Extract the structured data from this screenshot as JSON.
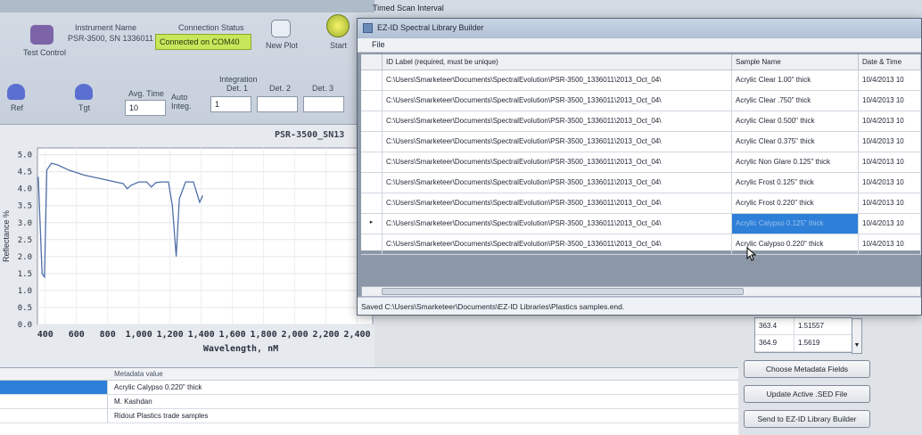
{
  "ribbon": {
    "tab_test_control": "Test Control",
    "instrument_name_label": "Instrument Name",
    "instrument_name_value": "PSR-3500, SN 1336011",
    "connection_status_label": "Connection Status",
    "connection_status_value": "Connected on COM40",
    "new_plot": "New Plot",
    "start": "Start",
    "timed_scan_interval": "Timed Scan Interval",
    "ref": "Ref",
    "tgt": "Tgt",
    "avg_time_label": "Avg. Time",
    "avg_time_value": "10",
    "auto_integ": "Auto Integ.",
    "integration_label": "Integration",
    "det1": "Det. 1",
    "det2": "Det. 2",
    "det3": "Det. 3",
    "det1_value": "1"
  },
  "chart_data": {
    "type": "line",
    "title": "PSR-3500_SN13",
    "xlabel": "Wavelength, nM",
    "ylabel": "Reflectance %",
    "xlim": [
      350,
      2500
    ],
    "ylim": [
      0.0,
      5.2
    ],
    "x_ticks": [
      "400",
      "600",
      "800",
      "1,000",
      "1,200",
      "1,400",
      "1,600",
      "1,800",
      "2,000",
      "2,200",
      "2,400"
    ],
    "y_ticks": [
      "0.0",
      "0.5",
      "1.0",
      "1.5",
      "2.0",
      "2.5",
      "3.0",
      "3.5",
      "4.0",
      "4.5",
      "5.0"
    ],
    "series": [
      {
        "values": [
          [
            355,
            4.35
          ],
          [
            380,
            1.5
          ],
          [
            395,
            1.4
          ],
          [
            410,
            4.55
          ],
          [
            440,
            4.75
          ],
          [
            480,
            4.7
          ],
          [
            550,
            4.55
          ],
          [
            650,
            4.4
          ],
          [
            750,
            4.3
          ],
          [
            850,
            4.2
          ],
          [
            900,
            4.15
          ],
          [
            925,
            4.0
          ],
          [
            950,
            4.1
          ],
          [
            1000,
            4.2
          ],
          [
            1050,
            4.2
          ],
          [
            1080,
            4.05
          ],
          [
            1110,
            4.18
          ],
          [
            1150,
            4.2
          ],
          [
            1190,
            4.2
          ],
          [
            1215,
            3.5
          ],
          [
            1240,
            2.0
          ],
          [
            1260,
            3.7
          ],
          [
            1300,
            4.2
          ],
          [
            1350,
            4.2
          ],
          [
            1390,
            3.6
          ],
          [
            1410,
            3.8
          ]
        ]
      }
    ]
  },
  "library_window": {
    "title": "EZ-ID Spectral Library Builder",
    "menu_file": "File",
    "col_id": "ID Label (required, must be unique)",
    "col_sample": "Sample Name",
    "col_date": "Date & Time",
    "rows": [
      {
        "id": "C:\\Users\\Smarketeer\\Documents\\SpectralEvolution\\PSR-3500_1336011\\2013_Oct_04\\",
        "sample": "Acrylic Clear 1.00\" thick",
        "date": "10/4/2013 10"
      },
      {
        "id": "C:\\Users\\Smarketeer\\Documents\\SpectralEvolution\\PSR-3500_1336011\\2013_Oct_04\\",
        "sample": "Acrylic Clear .750\" thick",
        "date": "10/4/2013 10"
      },
      {
        "id": "C:\\Users\\Smarketeer\\Documents\\SpectralEvolution\\PSR-3500_1336011\\2013_Oct_04\\",
        "sample": "Acrylic Clear 0.500\" thick",
        "date": "10/4/2013 10"
      },
      {
        "id": "C:\\Users\\Smarketeer\\Documents\\SpectralEvolution\\PSR-3500_1336011\\2013_Oct_04\\",
        "sample": "Acrylic Clear 0.375\" thick",
        "date": "10/4/2013 10"
      },
      {
        "id": "C:\\Users\\Smarketeer\\Documents\\SpectralEvolution\\PSR-3500_1336011\\2013_Oct_04\\",
        "sample": "Acrylic Non Glare 0.125\" thick",
        "date": "10/4/2013 10"
      },
      {
        "id": "C:\\Users\\Smarketeer\\Documents\\SpectralEvolution\\PSR-3500_1336011\\2013_Oct_04\\",
        "sample": "Acrylic Frost 0.125\" thick",
        "date": "10/4/2013 10"
      },
      {
        "id": "C:\\Users\\Smarketeer\\Documents\\SpectralEvolution\\PSR-3500_1336011\\2013_Oct_04\\",
        "sample": "Acrylic Frost 0.220\" thick",
        "date": "10/4/2013 10"
      },
      {
        "id": "C:\\Users\\Smarketeer\\Documents\\SpectralEvolution\\PSR-3500_1336011\\2013_Oct_04\\",
        "sample": "Acrylic Calypso 0.125\" thick",
        "date": "10/4/2013 10"
      },
      {
        "id": "C:\\Users\\Smarketeer\\Documents\\SpectralEvolution\\PSR-3500_1336011\\2013_Oct_04\\",
        "sample": "Acrylic Calypso 0.220\" thick",
        "date": "10/4/2013 10"
      }
    ],
    "status": "Saved C:\\Users\\Smarketeer\\Documents\\EZ-ID Libraries\\Plastics samples.end."
  },
  "side_list": {
    "rows": [
      {
        "a": "363.4",
        "b": "1.51557"
      },
      {
        "a": "364.9",
        "b": "1.5619"
      }
    ]
  },
  "side_buttons": {
    "choose_metadata": "Choose Metadata Fields",
    "update_sed": "Update Active .SED File",
    "send_library": "Send to EZ-ID Library Builder"
  },
  "metadata": {
    "header": "Metadata value",
    "rows": [
      "Acrylic Calypso 0.220\" thick",
      "M. Kashdan",
      "Ridout Plastics trade samples"
    ]
  },
  "colors": {
    "accent": "#2d7fd8",
    "connected": "#c8e65a"
  }
}
